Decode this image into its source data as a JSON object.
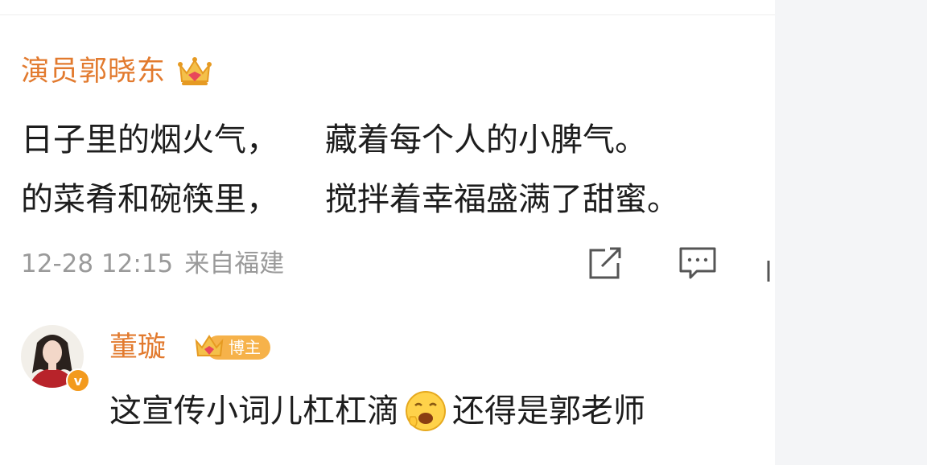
{
  "post": {
    "author": "演员郭晓东",
    "line1_a": "日子里的烟火气，",
    "line1_b": "藏着每个人的小脾气。",
    "line2_a": "的菜肴和碗筷里，",
    "line2_b": "搅拌着幸福盛满了甜蜜。",
    "timestamp": "12-28 12:15",
    "source": "来自福建",
    "icons": {
      "share": "share-icon",
      "comment": "comment-icon",
      "crown": "crown-icon"
    }
  },
  "reply": {
    "author": "董璇",
    "badge": "博主",
    "verified_mark": "v",
    "text_a": "这宣传小词儿杠杠滴",
    "text_b": "还得是郭老师"
  },
  "colors": {
    "name": "#e27a2e",
    "meta": "#9a9a9a",
    "badge": "#f6b24a",
    "verified": "#f39a1d",
    "side_panel": "#f4f5f7"
  }
}
